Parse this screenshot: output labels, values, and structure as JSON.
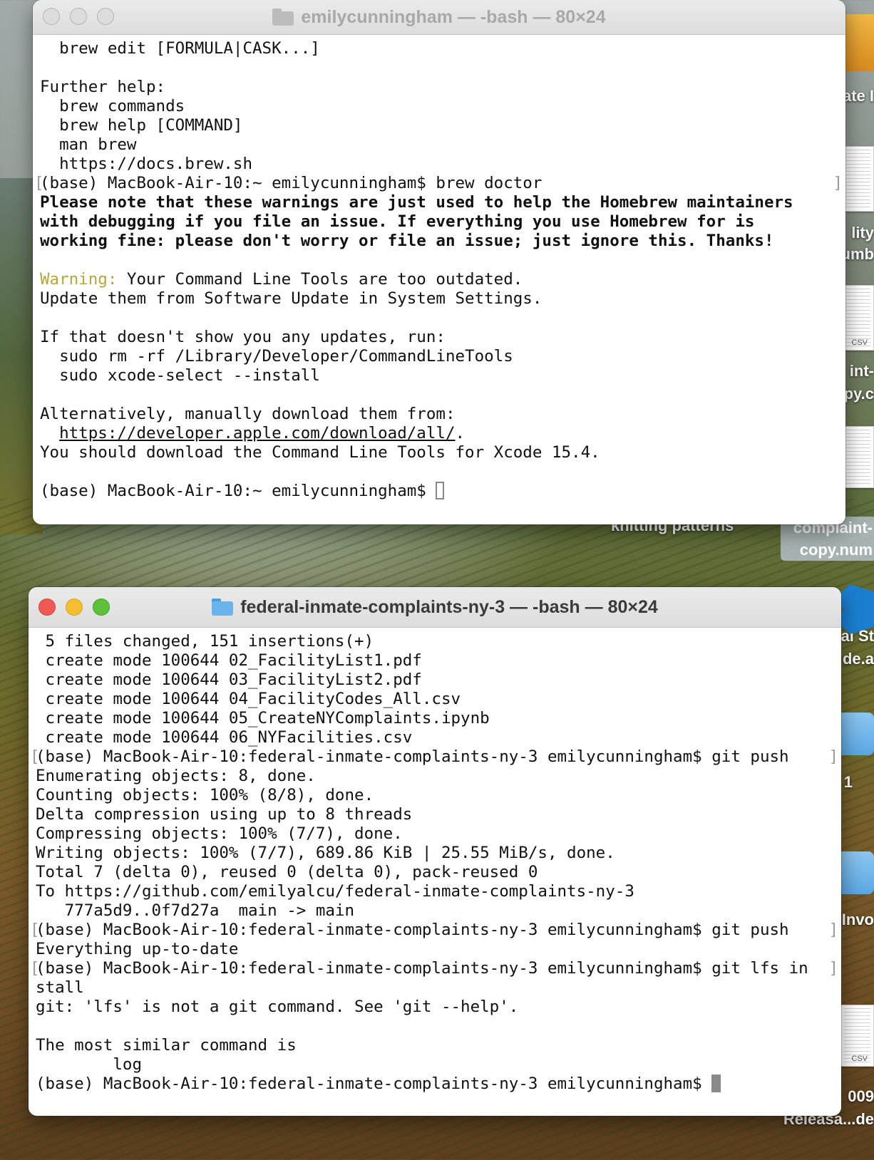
{
  "desktop": {
    "captions": {
      "knitting": "knitting patterns",
      "complaint_line1": "complaint-",
      "complaint_line2": "copy.num",
      "partial_ate": "ate I",
      "partial_ility": "lity",
      "partial_umb": "umb",
      "partial_int": "int-",
      "partial_py": "py.c",
      "partial_al_st": "al St",
      "partial_de_a": "de.a",
      "partial_one": "1",
      "partial_invo": "Invo",
      "partial_009": "009",
      "partial_releasa": "Releasa...de"
    },
    "csv_label": "CSV"
  },
  "window1": {
    "title": "emilycunningham — -bash — 80×24",
    "lines": [
      {
        "text": "  brew edit [FORMULA|CASK...]"
      },
      {
        "text": ""
      },
      {
        "text": "Further help:"
      },
      {
        "text": "  brew commands"
      },
      {
        "text": "  brew help [COMMAND]"
      },
      {
        "text": "  man brew"
      },
      {
        "text": "  https://docs.brew.sh"
      },
      {
        "text": "(base) MacBook-Air-10:~ emilycunningham$ brew doctor",
        "bracket": true
      },
      {
        "text": "Please note that these warnings are just used to help the Homebrew maintainers",
        "bold": true
      },
      {
        "text": "with debugging if you file an issue. If everything you use Homebrew for is",
        "bold": true
      },
      {
        "text": "working fine: please don't worry or file an issue; just ignore this. Thanks!",
        "bold": true
      },
      {
        "text": ""
      },
      {
        "warn": "Warning:",
        "text": " Your Command Line Tools are too outdated."
      },
      {
        "text": "Update them from Software Update in System Settings."
      },
      {
        "text": ""
      },
      {
        "text": "If that doesn't show you any updates, run:"
      },
      {
        "text": "  sudo rm -rf /Library/Developer/CommandLineTools"
      },
      {
        "text": "  sudo xcode-select --install"
      },
      {
        "text": ""
      },
      {
        "text": "Alternatively, manually download them from:"
      },
      {
        "pre": "  ",
        "url": "https://developer.apple.com/download/all/",
        "text": "."
      },
      {
        "text": "You should download the Command Line Tools for Xcode 15.4."
      },
      {
        "text": ""
      },
      {
        "text": "(base) MacBook-Air-10:~ emilycunningham$ ",
        "cursor": "hollow"
      }
    ]
  },
  "window2": {
    "title": "federal-inmate-complaints-ny-3 — -bash — 80×24",
    "lines": [
      {
        "text": " 5 files changed, 151 insertions(+)"
      },
      {
        "text": " create mode 100644 02_FacilityList1.pdf"
      },
      {
        "text": " create mode 100644 03_FacilityList2.pdf"
      },
      {
        "text": " create mode 100644 04_FacilityCodes_All.csv"
      },
      {
        "text": " create mode 100644 05_CreateNYComplaints.ipynb"
      },
      {
        "text": " create mode 100644 06_NYFacilities.csv"
      },
      {
        "text": "(base) MacBook-Air-10:federal-inmate-complaints-ny-3 emilycunningham$ git push",
        "bracket": true
      },
      {
        "text": "Enumerating objects: 8, done."
      },
      {
        "text": "Counting objects: 100% (8/8), done."
      },
      {
        "text": "Delta compression using up to 8 threads"
      },
      {
        "text": "Compressing objects: 100% (7/7), done."
      },
      {
        "text": "Writing objects: 100% (7/7), 689.86 KiB | 25.55 MiB/s, done."
      },
      {
        "text": "Total 7 (delta 0), reused 0 (delta 0), pack-reused 0"
      },
      {
        "text": "To https://github.com/emilyalcu/federal-inmate-complaints-ny-3"
      },
      {
        "text": "   777a5d9..0f7d27a  main -> main"
      },
      {
        "text": "(base) MacBook-Air-10:federal-inmate-complaints-ny-3 emilycunningham$ git push",
        "bracket": true
      },
      {
        "text": "Everything up-to-date"
      },
      {
        "text": "(base) MacBook-Air-10:federal-inmate-complaints-ny-3 emilycunningham$ git lfs in",
        "bracket": true
      },
      {
        "text": "stall"
      },
      {
        "text": "git: 'lfs' is not a git command. See 'git --help'."
      },
      {
        "text": ""
      },
      {
        "text": "The most similar command is"
      },
      {
        "text": "        log"
      },
      {
        "text": "(base) MacBook-Air-10:federal-inmate-complaints-ny-3 emilycunningham$ ",
        "cursor": "solid"
      }
    ]
  }
}
